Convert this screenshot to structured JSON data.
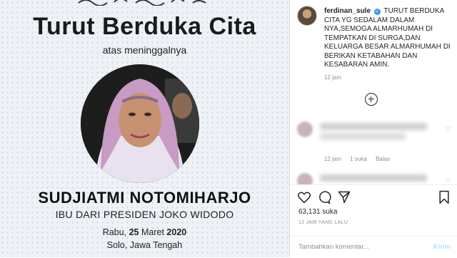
{
  "post": {
    "title": "Turut Berduka Cita",
    "subtitle": "atas meninggalnya",
    "name": "SUDJIATMI NOTOMIHARJO",
    "relation": "IBU DARI PRESIDEN JOKO WIDODO",
    "date_prefix": "Rabu, ",
    "date_bold": "25",
    "date_month": " Maret ",
    "date_year": "2020",
    "place": "Solo, Jawa Tengah"
  },
  "sidebar": {
    "username": "ferdinan_sule",
    "verified_mark": "✓",
    "caption": "TURUT BERDUKA CITA YG SEDALAM DALAM NYA,SEMOGA ALMARHUMAH DI TEMPATKAN DI SURGA,DAN KELUARGA BESAR ALMARHUMAH DI BERIKAN KETABAHAN DAN KESABARAN AMIN.",
    "caption_time": "12 jam",
    "comments": [
      {
        "time": "12 jam",
        "likes": "1 suka",
        "reply": "Balas"
      }
    ],
    "likes": "63,131 suka",
    "post_time": "12 JAM YANG LALU",
    "composer_placeholder": "Tambahkan komentar...",
    "send_label": "Kirim"
  },
  "icons": {
    "heart": "heart-icon",
    "comment": "comment-icon",
    "share": "share-icon",
    "save": "bookmark-icon",
    "load_more": "plus-circle-icon"
  },
  "colors": {
    "verified": "#3897f0",
    "send_disabled": "#b2dffc",
    "muted_text": "#8e8e8e"
  }
}
